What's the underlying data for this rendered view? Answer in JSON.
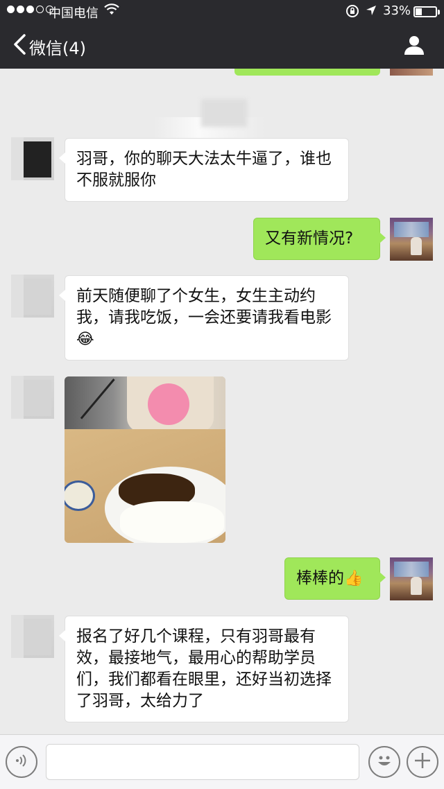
{
  "status_bar": {
    "carrier": "中国电信",
    "battery": "33%",
    "battery_level": 0.33,
    "signal_bars_full": 3,
    "signal_bars_total": 5
  },
  "nav": {
    "back_label": "微信(4)"
  },
  "messages": [
    {
      "from": "them",
      "type": "text",
      "text": "羽哥，你的聊天大法太牛逼了，谁也不服就服你"
    },
    {
      "from": "me",
      "type": "text",
      "text": "又有新情况?"
    },
    {
      "from": "them",
      "type": "text",
      "text": "前天随便聊了个女生，女生主动约我，请我吃饭，一会还要请我看电影",
      "emoji": "😂"
    },
    {
      "from": "them",
      "type": "image",
      "description": ""
    },
    {
      "from": "me",
      "type": "text",
      "text": "棒棒的",
      "emoji": "👍"
    },
    {
      "from": "them",
      "type": "text",
      "text": "报名了好几个课程，只有羽哥最有效，最接地气，最用心的帮助学员们，我们都看在眼里，还好当初选择了羽哥，太给力了"
    }
  ],
  "input_bar": {
    "placeholder": "",
    "icons": [
      "voice-icon",
      "emoji-icon",
      "plus-icon"
    ]
  },
  "colors": {
    "topbar": "#2a2a2e",
    "chat_bg": "#ebebeb",
    "my_bubble": "#a0e75a",
    "their_bubble": "#ffffff"
  }
}
